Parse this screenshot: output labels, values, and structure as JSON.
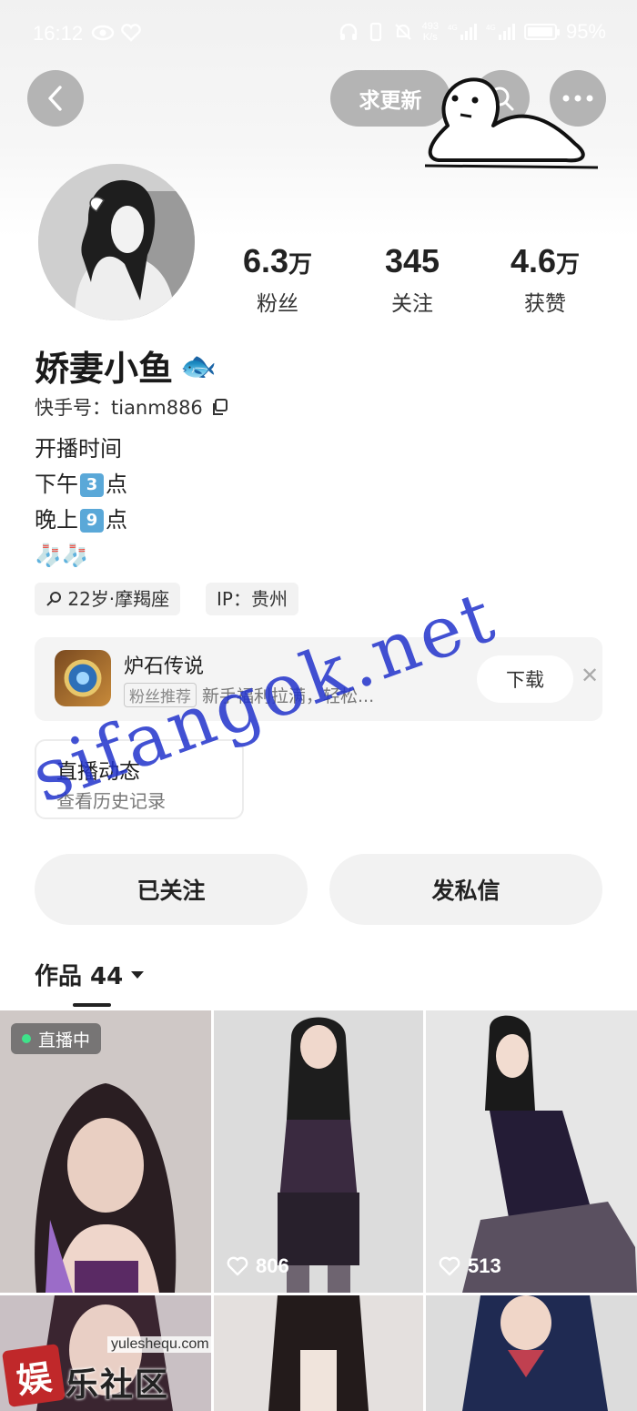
{
  "status_bar": {
    "time": "16:12",
    "net_speed_value": "493",
    "net_speed_unit": "K/s",
    "signal1_label": "4G",
    "signal2_label": "4G",
    "battery_percent_text": "95%",
    "battery_level": 0.95
  },
  "nav": {
    "request_update_label": "求更新"
  },
  "profile": {
    "name": "娇妻小鱼",
    "name_emoji": "🐟",
    "id_text": "快手号：tianm886",
    "stats": [
      {
        "value": "6.3",
        "unit": "万",
        "label": "粉丝"
      },
      {
        "value": "345",
        "unit": "",
        "label": "关注"
      },
      {
        "value": "4.6",
        "unit": "万",
        "label": "获赞"
      }
    ],
    "bio": {
      "line1": "开播时间",
      "line2_pre": "下午",
      "line2_key": "3",
      "line2_post": "点",
      "line3_pre": "晚上",
      "line3_key": "9",
      "line3_post": "点",
      "line4": "🧦🧦"
    },
    "tags": [
      "22岁·摩羯座",
      "IP：贵州"
    ]
  },
  "promo": {
    "title": "炉石传说",
    "badge": "粉丝推荐",
    "desc": "新手福利拉满，轻松...",
    "download_label": "下载",
    "close_glyph": "✕"
  },
  "live_history": {
    "title": "直播动态",
    "subtitle": "查看历史记录"
  },
  "actions": {
    "following_label": "已关注",
    "message_label": "发私信"
  },
  "works": {
    "label": "作品 44",
    "items": [
      {
        "badge": "直播中",
        "likes": ""
      },
      {
        "badge": "",
        "likes": "806"
      },
      {
        "badge": "",
        "likes": "513"
      }
    ]
  },
  "watermarks": {
    "site_text": "sifangok.net",
    "corner_url": "yuleshequ.com",
    "corner_mark": "娱",
    "corner_brand": "乐社区"
  }
}
